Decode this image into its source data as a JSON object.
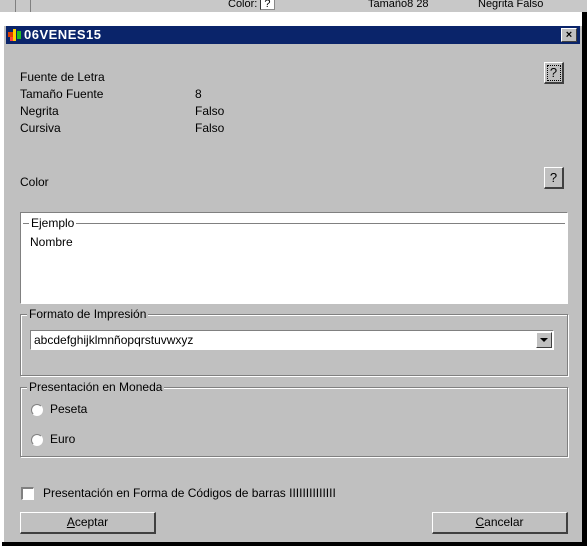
{
  "background_window": {
    "color_label": "Color:",
    "color_value": "?",
    "size_label": "Tamaño",
    "size_value": "8 28",
    "bold_label": "Negrita",
    "bold_value": "Falso"
  },
  "dialog": {
    "title": "06VENES15",
    "close_glyph": "×",
    "help_glyph": "?"
  },
  "properties": {
    "font_label": "Fuente de Letra",
    "font_value": "",
    "size_label": "Tamaño Fuente",
    "size_value": "8",
    "bold_label": "Negrita",
    "bold_value": "Falso",
    "italic_label": "Cursiva",
    "italic_value": "Falso",
    "color_label": "Color"
  },
  "example": {
    "legend": "Ejemplo",
    "text": "Nombre"
  },
  "print_format": {
    "legend": "Formato de Impresión",
    "selected": "abcdefghijklmnñopqrstuvwxyz"
  },
  "currency": {
    "legend": "Presentación en Moneda",
    "options": [
      "Peseta",
      "Euro"
    ],
    "selected": null
  },
  "barcode": {
    "label": "Presentación en Forma de Códigos de barras IIIIIIIIIIIIII",
    "checked": false
  },
  "buttons": {
    "accept_prefix": "A",
    "accept_rest": "ceptar",
    "cancel_prefix": "C",
    "cancel_rest": "ancelar"
  },
  "colors": {
    "titlebar": "#0a246a",
    "face": "#c0c0c0"
  },
  "icons": {
    "app": "app-icon",
    "close": "close-icon",
    "dropdown": "chevron-down-icon"
  }
}
